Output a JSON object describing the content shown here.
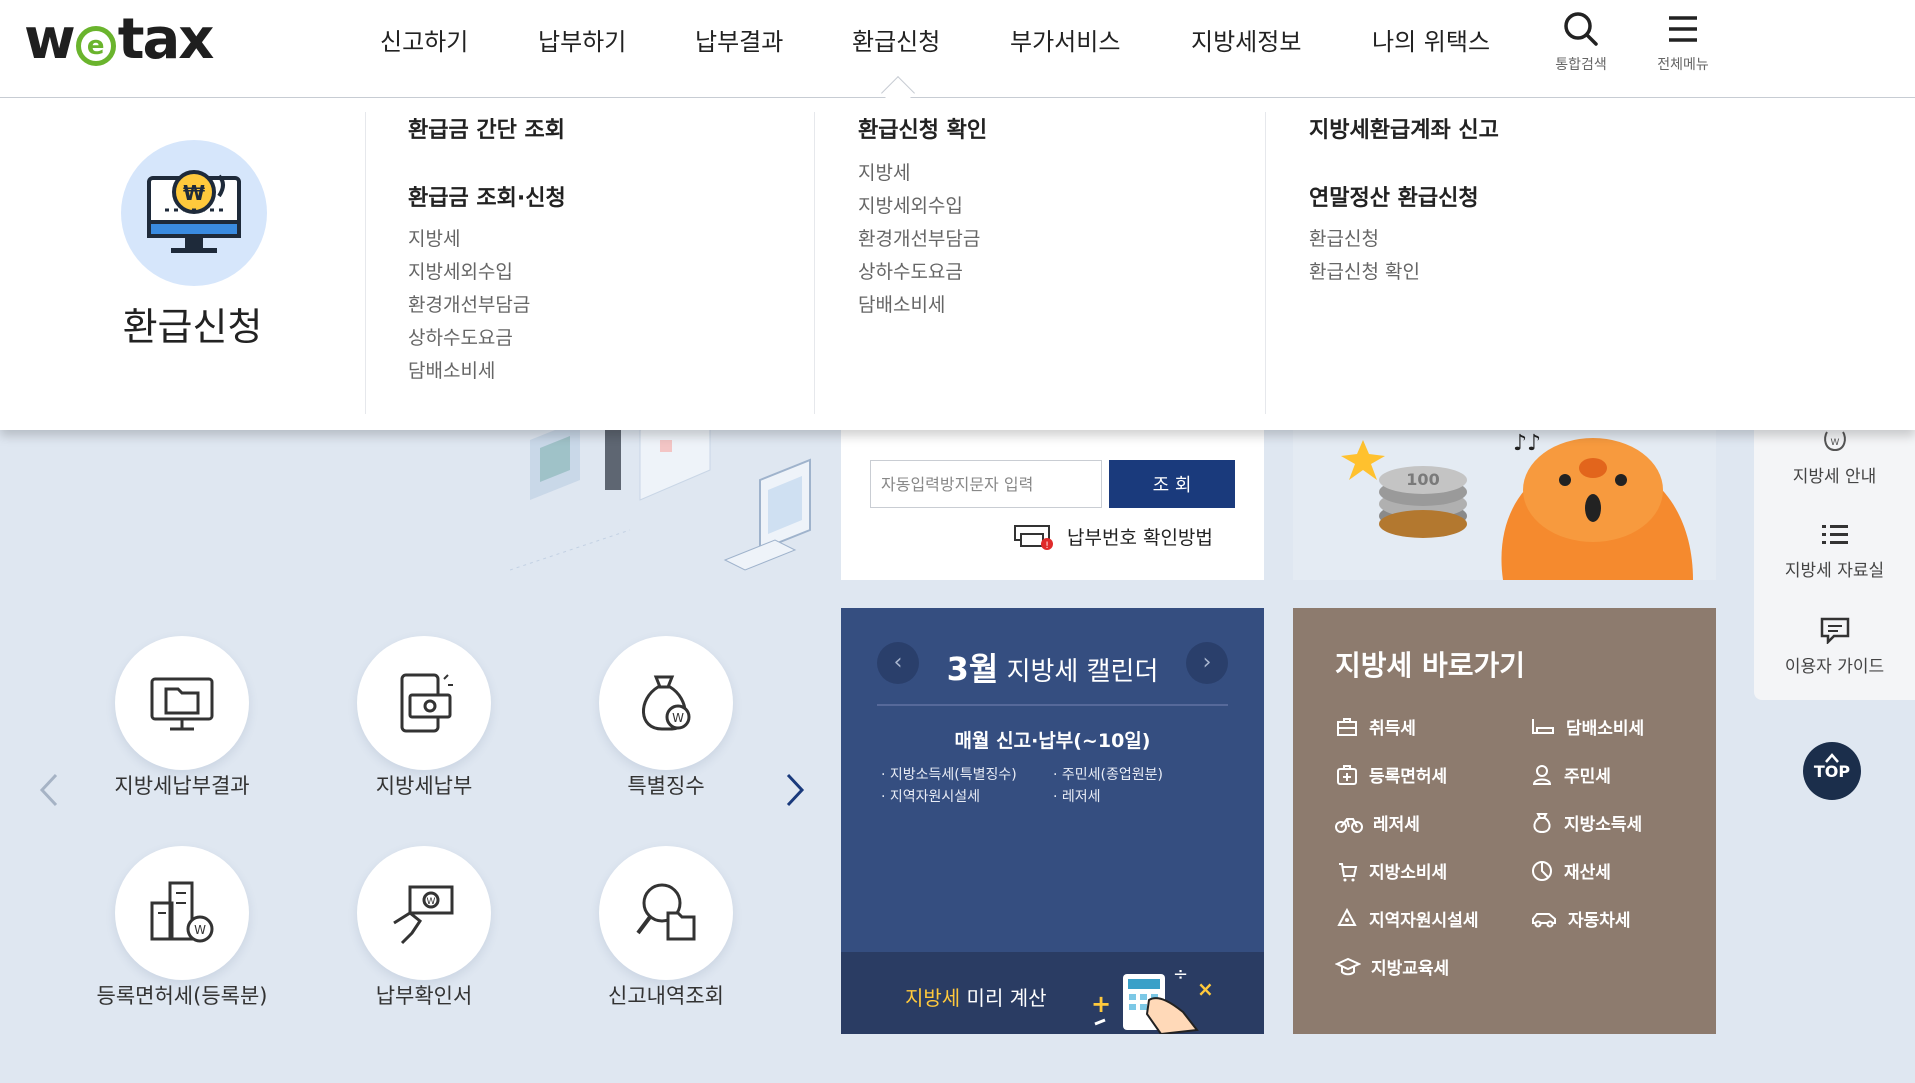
{
  "header": {
    "logo": {
      "prefix": "w",
      "e": "e",
      "suffix": "tax"
    },
    "nav": [
      "신고하기",
      "납부하기",
      "납부결과",
      "환급신청",
      "부가서비스",
      "지방세정보",
      "나의 위택스"
    ],
    "search_label": "통합검색",
    "menu_label": "전체메뉴"
  },
  "mega_menu": {
    "title": "환급신청",
    "col1": {
      "heading1": "환급금 간단 조회",
      "heading2": "환급금 조회·신청",
      "links": [
        "지방세",
        "지방세외수입",
        "환경개선부담금",
        "상하수도요금",
        "담배소비세"
      ]
    },
    "col2": {
      "heading1": "환급신청 확인",
      "links": [
        "지방세",
        "지방세외수입",
        "환경개선부담금",
        "상하수도요금",
        "담배소비세"
      ]
    },
    "col3": {
      "heading1": "지방세환급계좌 신고",
      "heading2": "연말정산 환급신청",
      "links": [
        "환급신청",
        "환급신청 확인"
      ]
    }
  },
  "services": [
    {
      "label": "지방세납부결과",
      "icon": "monitor-folder-icon"
    },
    {
      "label": "지방세납부",
      "icon": "phone-payment-icon"
    },
    {
      "label": "특별징수",
      "icon": "money-bag-icon"
    },
    {
      "label": "등록면허세(등록분)",
      "icon": "building-won-icon"
    },
    {
      "label": "납부확인서",
      "icon": "hand-ticket-icon"
    },
    {
      "label": "신고내역조회",
      "icon": "magnifier-folder-icon"
    }
  ],
  "search": {
    "captcha_placeholder": "자동입력방지문자 입력",
    "query_button": "조 회",
    "paynum_link": "납부번호 확인방법"
  },
  "calendar": {
    "month": "3월",
    "title": "지방세 캘린더",
    "subtitle": "매월 신고·납부(~10일)",
    "items": [
      "지방소득세(특별징수)",
      "주민세(종업원분)",
      "지역자원시설세",
      "레저세"
    ],
    "footer_highlight": "지방세",
    "footer_rest": " 미리 계산"
  },
  "shortcuts": {
    "title": "지방세 바로가기",
    "items": [
      "취득세",
      "담배소비세",
      "등록면허세",
      "주민세",
      "레저세",
      "지방소득세",
      "지방소비세",
      "재산세",
      "지역자원시설세",
      "자동차세",
      "지방교육세"
    ]
  },
  "quick_menu": {
    "items": [
      "지방세 안내",
      "지방세 자료실",
      "이용자 가이드"
    ],
    "top": "TOP"
  },
  "colors": {
    "navy": "#1a3a7c",
    "calendar_bg": "#354e80",
    "shortcut_bg": "#8d7b6e",
    "page_bg": "#dfe7f1",
    "logo_green": "#6ab42d"
  }
}
